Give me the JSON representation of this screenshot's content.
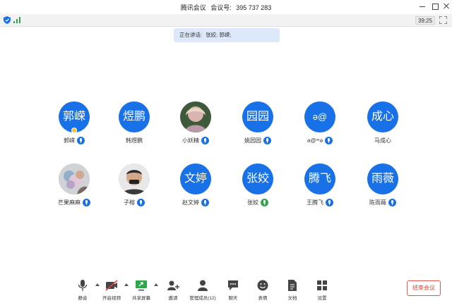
{
  "window": {
    "app_name": "腾讯会议",
    "meeting_id_label": "会议号:",
    "meeting_id": "395 737 283"
  },
  "status": {
    "timer": "39:25",
    "icons": [
      "shield-icon",
      "signal-icon",
      "fullscreen-icon"
    ]
  },
  "speaking": {
    "label": "正在讲话:",
    "speakers": "张姣; 郭嵘;"
  },
  "participants": [
    {
      "avatar_text": "郭嵘",
      "name": "郭嵘",
      "mic": "active",
      "host": true
    },
    {
      "avatar_text": "煜鹏",
      "name": "韩煜鹏",
      "mic": "none"
    },
    {
      "avatar_text": "",
      "name": "小妖精",
      "mic": "active",
      "photo": "portrait"
    },
    {
      "avatar_text": "园园",
      "name": "姚园园",
      "mic": "active"
    },
    {
      "avatar_text": "ə@",
      "name": "ə@ꟹə",
      "mic": "active"
    },
    {
      "avatar_text": "成心",
      "name": "马成心",
      "mic": "none"
    },
    {
      "avatar_text": "",
      "name": "芒果麻麻",
      "mic": "active",
      "photo": "flowers"
    },
    {
      "avatar_text": "",
      "name": "子榕",
      "mic": "active",
      "photo": "man"
    },
    {
      "avatar_text": "文婷",
      "name": "赵文婷",
      "mic": "active"
    },
    {
      "avatar_text": "张姣",
      "name": "张姣",
      "mic": "speaking"
    },
    {
      "avatar_text": "腾飞",
      "name": "王腾飞",
      "mic": "active"
    },
    {
      "avatar_text": "雨薇",
      "name": "陈雨薇",
      "mic": "active"
    }
  ],
  "toolbar": {
    "mute": "静音",
    "video": "开启视频",
    "share": "共享屏幕",
    "invite": "邀请",
    "members": "管理成员(12)",
    "chat": "聊天",
    "reactions": "表情",
    "docs": "文档",
    "settings": "设置",
    "end": "结束会议"
  },
  "colors": {
    "avatar_blue": "#1871e6",
    "banner_bg": "#dde9fa",
    "end_red": "#e0443a",
    "speaking_green": "#2ea64a"
  }
}
